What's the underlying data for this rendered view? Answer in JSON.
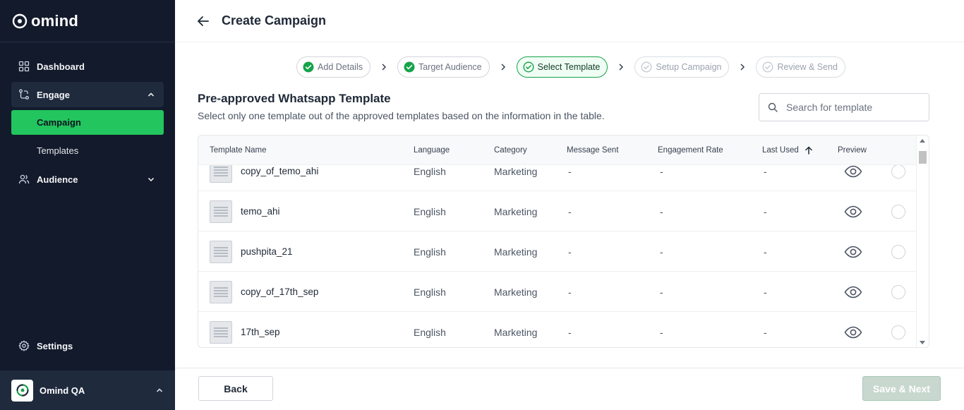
{
  "brand": {
    "name": "omind"
  },
  "sidebar": {
    "items": [
      {
        "label": "Dashboard",
        "icon": "grid-icon"
      },
      {
        "label": "Engage",
        "icon": "workflow-icon",
        "expanded": true,
        "children": [
          {
            "label": "Campaign",
            "active": true
          },
          {
            "label": "Templates"
          }
        ]
      },
      {
        "label": "Audience",
        "icon": "users-icon",
        "expanded": false
      }
    ],
    "settings_label": "Settings",
    "org_name": "Omind QA"
  },
  "header": {
    "title": "Create Campaign"
  },
  "stepper": {
    "steps": [
      {
        "label": "Add Details",
        "state": "done"
      },
      {
        "label": "Target Audience",
        "state": "done"
      },
      {
        "label": "Select Template",
        "state": "current"
      },
      {
        "label": "Setup Campaign",
        "state": "todo"
      },
      {
        "label": "Review & Send",
        "state": "todo"
      }
    ]
  },
  "section": {
    "title": "Pre-approved Whatsapp Template",
    "description": "Select only one template out of the approved templates based on the information in the table."
  },
  "search": {
    "placeholder": "Search for template",
    "value": ""
  },
  "table": {
    "columns": [
      "Template Name",
      "Language",
      "Category",
      "Message Sent",
      "Engagement Rate",
      "Last Used",
      "Preview"
    ],
    "sort": {
      "column": "Last Used",
      "direction": "ascending"
    },
    "rows": [
      {
        "name": "copy_of_temo_ahi",
        "language": "English",
        "category": "Marketing",
        "sent": "-",
        "engagement": "-",
        "last_used": "-",
        "selected": false
      },
      {
        "name": "temo_ahi",
        "language": "English",
        "category": "Marketing",
        "sent": "-",
        "engagement": "-",
        "last_used": "-",
        "selected": false
      },
      {
        "name": "pushpita_21",
        "language": "English",
        "category": "Marketing",
        "sent": "-",
        "engagement": "-",
        "last_used": "-",
        "selected": false
      },
      {
        "name": "copy_of_17th_sep",
        "language": "English",
        "category": "Marketing",
        "sent": "-",
        "engagement": "-",
        "last_used": "-",
        "selected": false
      },
      {
        "name": "17th_sep",
        "language": "English",
        "category": "Marketing",
        "sent": "-",
        "engagement": "-",
        "last_used": "-",
        "selected": false
      }
    ]
  },
  "footer": {
    "back_label": "Back",
    "next_label": "Save & Next",
    "next_enabled": false
  },
  "colors": {
    "sidebar_bg": "#121a2b",
    "accent": "#22c55e",
    "active_step": "#16a34a",
    "disabled_button": "#c9d8cf"
  }
}
